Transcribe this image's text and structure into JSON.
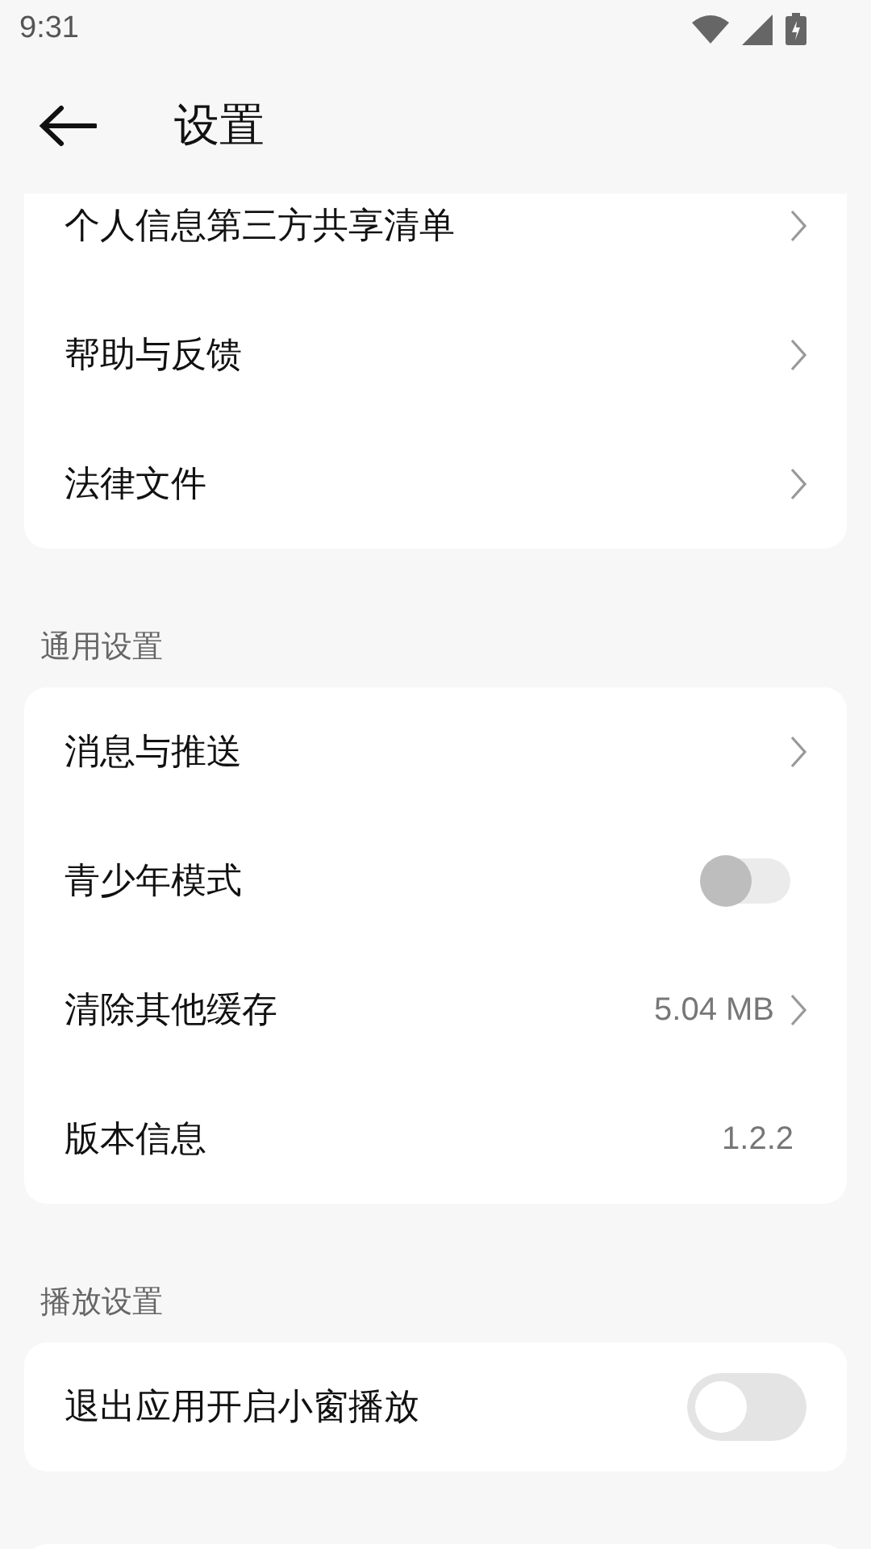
{
  "status_bar": {
    "time": "9:31"
  },
  "header": {
    "title": "设置"
  },
  "sections": [
    {
      "items": [
        {
          "kind": "link",
          "label": "个人信息第三方共享清单"
        },
        {
          "kind": "link",
          "label": "帮助与反馈"
        },
        {
          "kind": "link",
          "label": "法律文件"
        }
      ]
    },
    {
      "title": "通用设置",
      "items": [
        {
          "kind": "link",
          "label": "消息与推送"
        },
        {
          "kind": "toggle",
          "label": "青少年模式",
          "on": false,
          "disabled": true
        },
        {
          "kind": "link",
          "label": "清除其他缓存",
          "value": "5.04 MB"
        },
        {
          "kind": "info",
          "label": "版本信息",
          "value": "1.2.2"
        }
      ]
    },
    {
      "title": "播放设置",
      "items": [
        {
          "kind": "toggle",
          "label": "退出应用开启小窗播放",
          "on": false,
          "disabled": false
        }
      ]
    },
    {
      "kind": "empty_card"
    }
  ]
}
